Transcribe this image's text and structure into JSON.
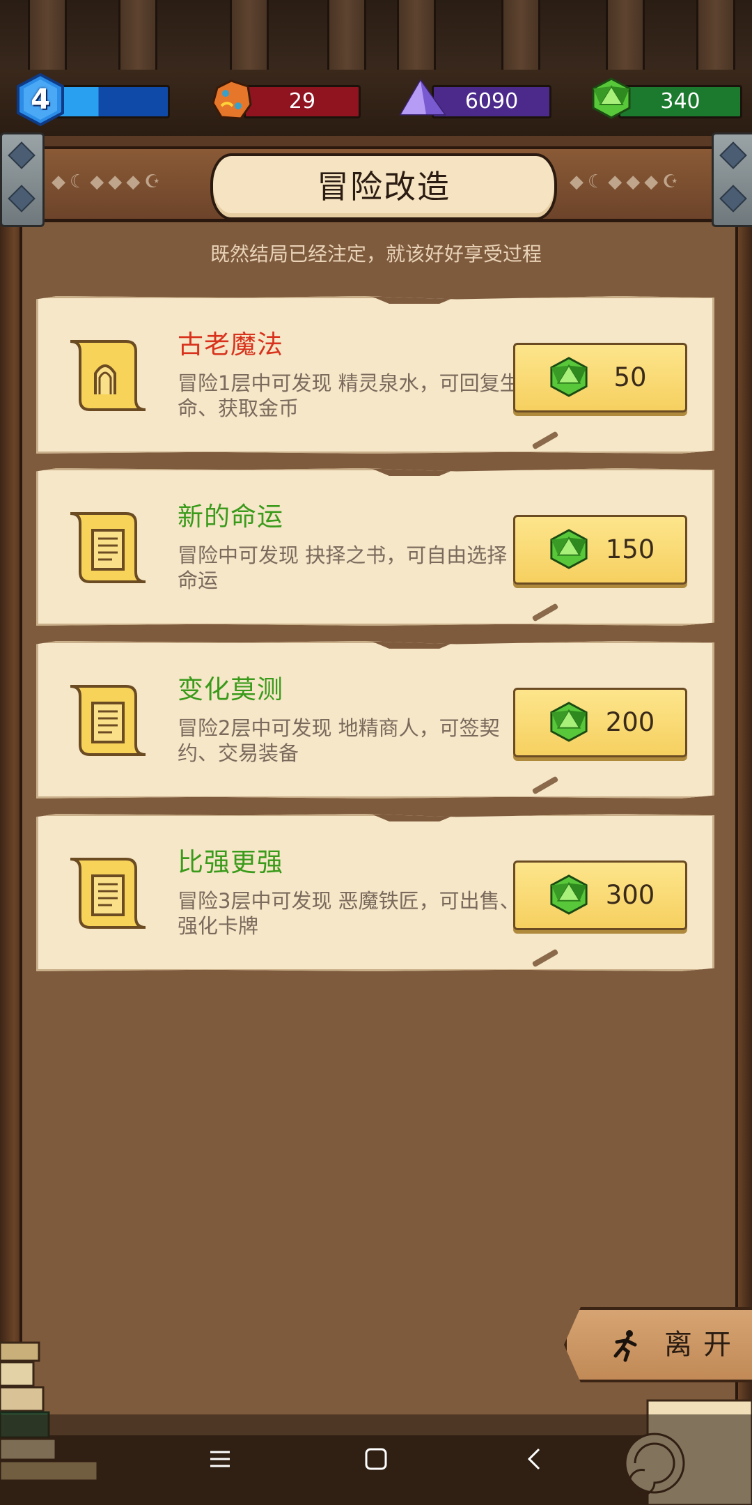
{
  "resources": {
    "level": "4",
    "stone": "29",
    "crystal": "6090",
    "gem": "340"
  },
  "header": {
    "title": "冒险改造",
    "subtitle": "既然结局已经注定，就该好好享受过程"
  },
  "upgrades": [
    {
      "title": "古老魔法",
      "desc": "冒险1层中可发现 精灵泉水，可回复生命、获取金币",
      "price": "50",
      "title_color": "#d8321c"
    },
    {
      "title": "新的命运",
      "desc": "冒险中可发现 抉择之书，可自由选择命运",
      "price": "150",
      "title_color": "#3a9a1a"
    },
    {
      "title": "变化莫测",
      "desc": "冒险2层中可发现 地精商人，可签契约、交易装备",
      "price": "200",
      "title_color": "#3a9a1a"
    },
    {
      "title": "比强更强",
      "desc": "冒险3层中可发现 恶魔铁匠，可出售、强化卡牌",
      "price": "300",
      "title_color": "#3a9a1a"
    }
  ],
  "leave": {
    "label": "离开"
  },
  "icons": {
    "level": "blue-hexagon-badge",
    "stone": "orange-rune-stone-icon",
    "crystal": "purple-crystal-icon",
    "gem": "green-gem-icon",
    "scroll": "scroll-icon",
    "leave": "running-man-icon"
  },
  "colors": {
    "level_bar": "#1f7fe0",
    "stone_bar": "#8f1420",
    "crystal_bar": "#4b2a8c",
    "gem_bar": "#1b7a2e"
  }
}
